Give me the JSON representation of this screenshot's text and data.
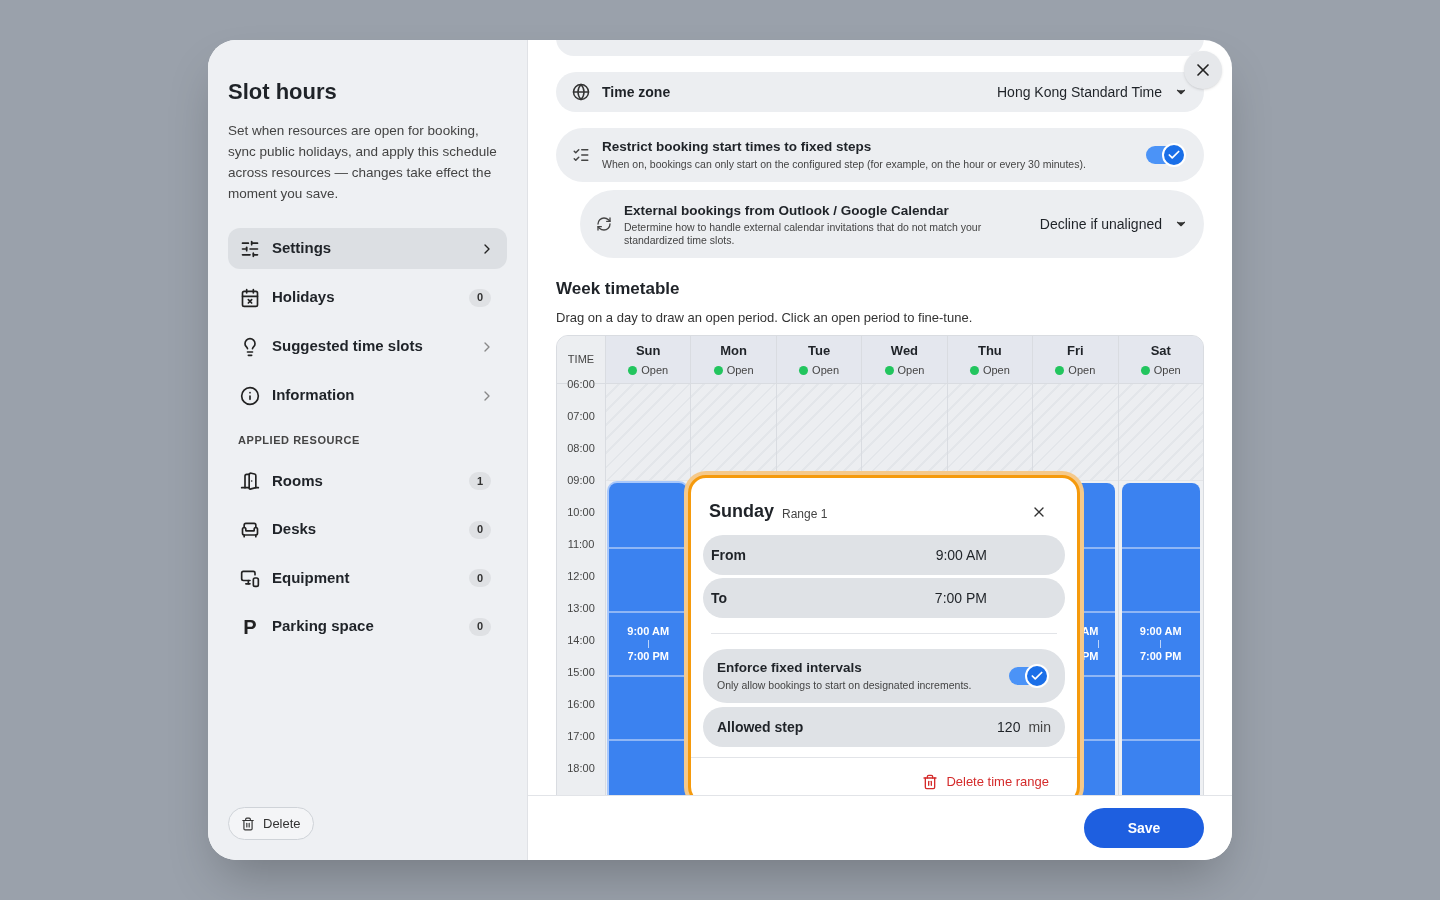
{
  "sidebar": {
    "title": "Slot hours",
    "description": "Set when resources are open for booking, sync public holidays, and apply this schedule across resources — changes take effect the moment you save.",
    "nav": [
      {
        "label": "Settings",
        "chevron": true,
        "selected": true
      },
      {
        "label": "Holidays",
        "badge": "0",
        "chevron": false,
        "selected": false
      },
      {
        "label": "Suggested time slots",
        "chevron": true,
        "selected": false
      },
      {
        "label": "Information",
        "chevron": true,
        "selected": false
      }
    ],
    "section_label": "APPLIED RESOURCE",
    "resources": [
      {
        "label": "Rooms",
        "badge": "1"
      },
      {
        "label": "Desks",
        "badge": "0"
      },
      {
        "label": "Equipment",
        "badge": "0"
      },
      {
        "label": "Parking space",
        "glyph": "P",
        "badge": "0"
      }
    ],
    "delete_button": "Delete"
  },
  "time_zone": {
    "label": "Time zone",
    "value": "Hong Kong Standard Time"
  },
  "restrict": {
    "title": "Restrict booking start times to fixed steps",
    "description": "When on, bookings can only start on the configured step (for example, on the hour or every 30 minutes).",
    "on": true
  },
  "external": {
    "title": "External bookings from Outlook / Google Calendar",
    "description": "Determine how to handle external calendar invitations that do not match your standardized time slots.",
    "value": "Decline if unaligned"
  },
  "week": {
    "title": "Week timetable",
    "subtitle": "Drag on a day to draw an open period. Click an open period to fine-tune.",
    "time_header": "TIME",
    "hours": [
      "06:00",
      "07:00",
      "08:00",
      "09:00",
      "10:00",
      "11:00",
      "12:00",
      "13:00",
      "14:00",
      "15:00",
      "16:00",
      "17:00",
      "18:00"
    ],
    "days": [
      {
        "name": "Sun",
        "status": "Open",
        "color": "#22c55e",
        "block": {
          "kind": "full",
          "from": "9:00 AM",
          "to": "7:00 PM",
          "selected": true
        }
      },
      {
        "name": "Mon",
        "status": "Open",
        "color": "#22c55e"
      },
      {
        "name": "Tue",
        "status": "Open",
        "color": "#22c55e"
      },
      {
        "name": "Wed",
        "status": "Open",
        "color": "#22c55e"
      },
      {
        "name": "Thu",
        "status": "Open",
        "color": "#22c55e"
      },
      {
        "name": "Fri",
        "status": "Open",
        "color": "#22c55e",
        "block": {
          "kind": "partial",
          "from": "AM",
          "to": "PM",
          "selected": false
        }
      },
      {
        "name": "Sat",
        "status": "Open",
        "color": "#22c55e",
        "block": {
          "kind": "full",
          "from": "9:00 AM",
          "to": "7:00 PM",
          "selected": false
        }
      }
    ]
  },
  "popover": {
    "day": "Sunday",
    "range": "Range 1",
    "from_label": "From",
    "from": "9:00 AM",
    "to_label": "To",
    "to": "7:00 PM",
    "enforce": {
      "title": "Enforce fixed intervals",
      "description": "Only allow bookings to start on designated increments.",
      "on": true
    },
    "step_label": "Allowed step",
    "step": "120",
    "unit": "min",
    "delete": "Delete time range"
  },
  "save_button": "Save"
}
